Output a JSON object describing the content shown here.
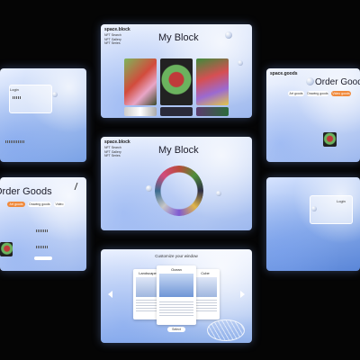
{
  "panels": {
    "top": {
      "brand": "space.block",
      "links": [
        "NFT Search",
        "NFT Gallery",
        "NFT Series"
      ],
      "title": "My Block"
    },
    "middle": {
      "brand": "space.block",
      "links": [
        "NFT Search",
        "NFT Gallery",
        "NFT Series"
      ],
      "title": "My Block"
    },
    "left_top": {
      "login": "Login"
    },
    "left_bottom": {
      "title": "Order Goods",
      "tabs": [
        "Art goods",
        "Drawing goods",
        "Video"
      ]
    },
    "right_top": {
      "brand": "space.goods",
      "title": "Order Goods",
      "tabs": [
        "Art goods",
        "Drawing goods",
        "Video goods"
      ]
    },
    "right_bottom": {
      "login": "Login"
    },
    "bottom": {
      "heading": "Customize your window",
      "cards": [
        "Landscape",
        "Ocean",
        "Cube"
      ],
      "button": "Select"
    }
  }
}
